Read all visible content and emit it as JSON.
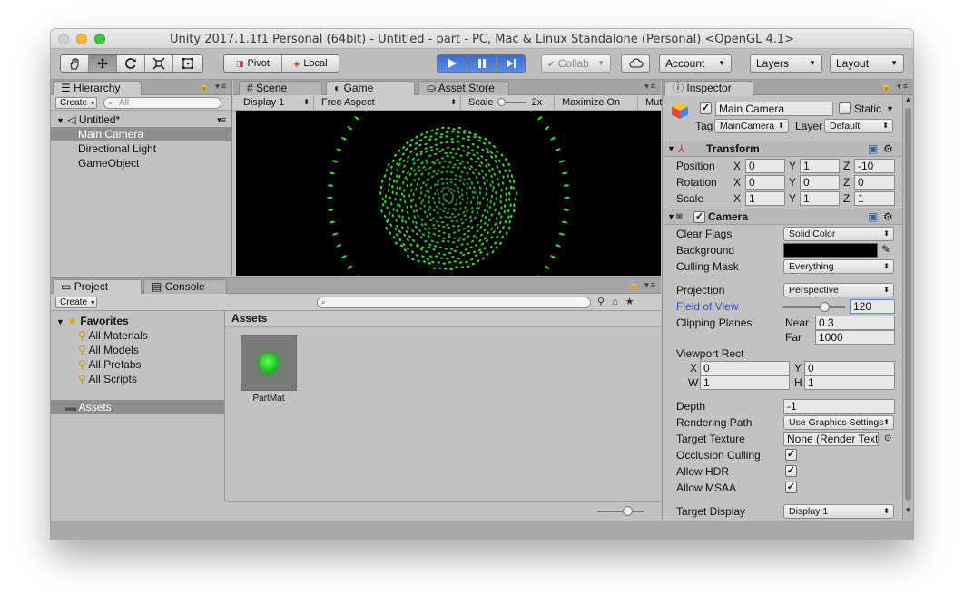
{
  "window": {
    "title": "Unity 2017.1.1f1 Personal (64bit) - Untitled - part - PC, Mac & Linux Standalone (Personal) <OpenGL 4.1>"
  },
  "toolbar": {
    "pivot_label": "Pivot",
    "local_label": "Local",
    "collab_label": "Collab",
    "account_label": "Account",
    "layers_label": "Layers",
    "layout_label": "Layout"
  },
  "hierarchy": {
    "tab": "Hierarchy",
    "create_label": "Create",
    "search_placeholder": "All",
    "scene_name": "Untitled*",
    "items": [
      "Main Camera",
      "Directional Light",
      "GameObject"
    ],
    "selected_index": 0
  },
  "center_tabs": {
    "scene": "Scene",
    "game": "Game",
    "asset_store": "Asset Store"
  },
  "game_bar": {
    "display": "Display 1",
    "aspect": "Free Aspect",
    "scale_label": "Scale",
    "scale_value": "2x",
    "maximize": "Maximize On Play",
    "mute": "Mut"
  },
  "project": {
    "tab": "Project",
    "console_tab": "Console",
    "create_label": "Create",
    "favorites_label": "Favorites",
    "favorites": [
      "All Materials",
      "All Models",
      "All Prefabs",
      "All Scripts"
    ],
    "assets_folder": "Assets",
    "assets_header": "Assets",
    "asset_items": [
      {
        "name": "PartMat"
      }
    ]
  },
  "inspector": {
    "tab": "Inspector",
    "object_name": "Main Camera",
    "static_label": "Static",
    "tag_label": "Tag",
    "tag_value": "MainCamera",
    "layer_label": "Layer",
    "layer_value": "Default",
    "transform": {
      "title": "Transform",
      "rows": [
        {
          "label": "Position",
          "x": "0",
          "y": "1",
          "z": "-10"
        },
        {
          "label": "Rotation",
          "x": "0",
          "y": "0",
          "z": "0"
        },
        {
          "label": "Scale",
          "x": "1",
          "y": "1",
          "z": "1"
        }
      ]
    },
    "camera": {
      "title": "Camera",
      "clear_flags_label": "Clear Flags",
      "clear_flags_value": "Solid Color",
      "background_label": "Background",
      "background_color": "#000000",
      "culling_mask_label": "Culling Mask",
      "culling_mask_value": "Everything",
      "projection_label": "Projection",
      "projection_value": "Perspective",
      "fov_label": "Field of View",
      "fov_value": "120",
      "fov_fraction": 0.66,
      "clipping_label": "Clipping Planes",
      "near_label": "Near",
      "near_value": "0.3",
      "far_label": "Far",
      "far_value": "1000",
      "viewport_label": "Viewport Rect",
      "vp_x": "0",
      "vp_y": "0",
      "vp_w": "1",
      "vp_h": "1",
      "depth_label": "Depth",
      "depth_value": "-1",
      "rendering_path_label": "Rendering Path",
      "rendering_path_value": "Use Graphics Settings",
      "target_texture_label": "Target Texture",
      "target_texture_value": "None (Render Text",
      "occlusion_label": "Occlusion Culling",
      "hdr_label": "Allow HDR",
      "msaa_label": "Allow MSAA",
      "target_display_label": "Target Display",
      "target_display_value": "Display 1"
    }
  },
  "colors": {
    "particle_green": "#3cdc3c",
    "play_blue": "#3b6fd0",
    "selection_gray": "#8e8e8e"
  }
}
